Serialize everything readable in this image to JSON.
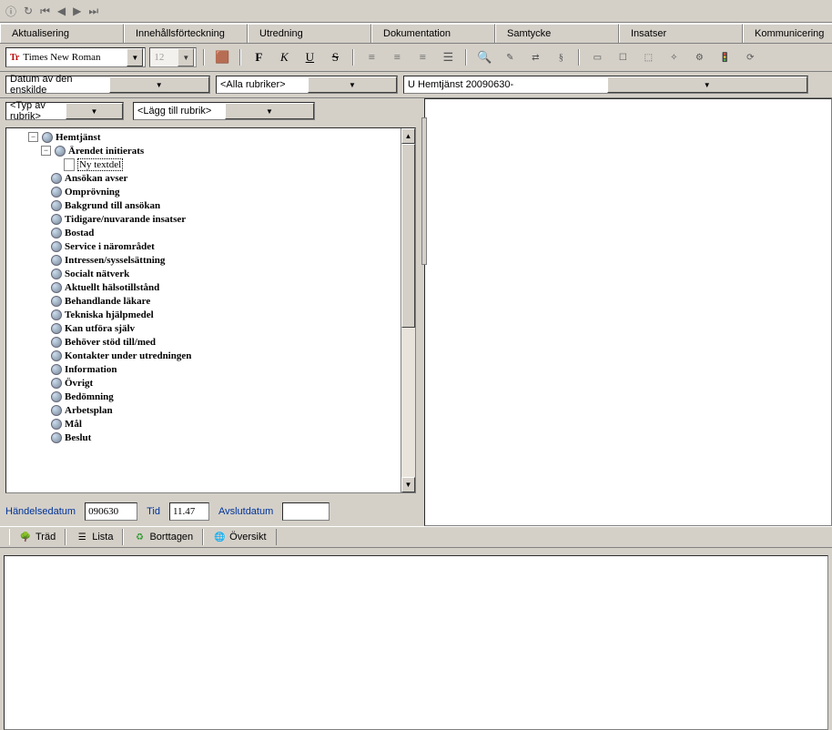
{
  "tabs": {
    "aktualisering": "Aktualisering",
    "innehall": "Innehållsförteckning",
    "utredning": "Utredning",
    "dokumentation": "Dokumentation",
    "samtycke": "Samtycke",
    "insatser": "Insatser",
    "kommunicering": "Kommunicering"
  },
  "fmt": {
    "font_name": "Times New Roman",
    "font_size": "12"
  },
  "filters": {
    "datum": "Datum av den enskilde",
    "rubriker": "<Alla rubriker>",
    "period": "U Hemtjänst 20090630-"
  },
  "rubrik": {
    "typ": "<Typ av rubrik>",
    "lagg": "<Lägg till rubrik>"
  },
  "tree": {
    "root": "Hemtjänst",
    "initierats": "Ärendet initierats",
    "nytext": "Ny textdel",
    "items": [
      "Ansökan avser",
      "Omprövning",
      "Bakgrund till ansökan",
      "Tidigare/nuvarande insatser",
      "Bostad",
      "Service i närområdet",
      "Intressen/sysselsättning",
      "Socialt nätverk",
      "Aktuellt hälsotillstånd",
      "Behandlande läkare",
      "Tekniska hjälpmedel",
      "Kan utföra själv",
      "Behöver stöd till/med",
      "Kontakter under utredningen",
      "Information",
      "Övrigt",
      "Bedömning",
      "Arbetsplan",
      "Mål",
      "Beslut"
    ]
  },
  "dates": {
    "handelsedatum_label": "Händelsedatum",
    "handelsedatum_value": "090630",
    "tid_label": "Tid",
    "tid_value": "11.47",
    "avslut_label": "Avslutdatum",
    "avslut_value": ""
  },
  "viewtabs": {
    "trad": "Träd",
    "lista": "Lista",
    "borttagen": "Borttagen",
    "oversikt": "Översikt"
  }
}
